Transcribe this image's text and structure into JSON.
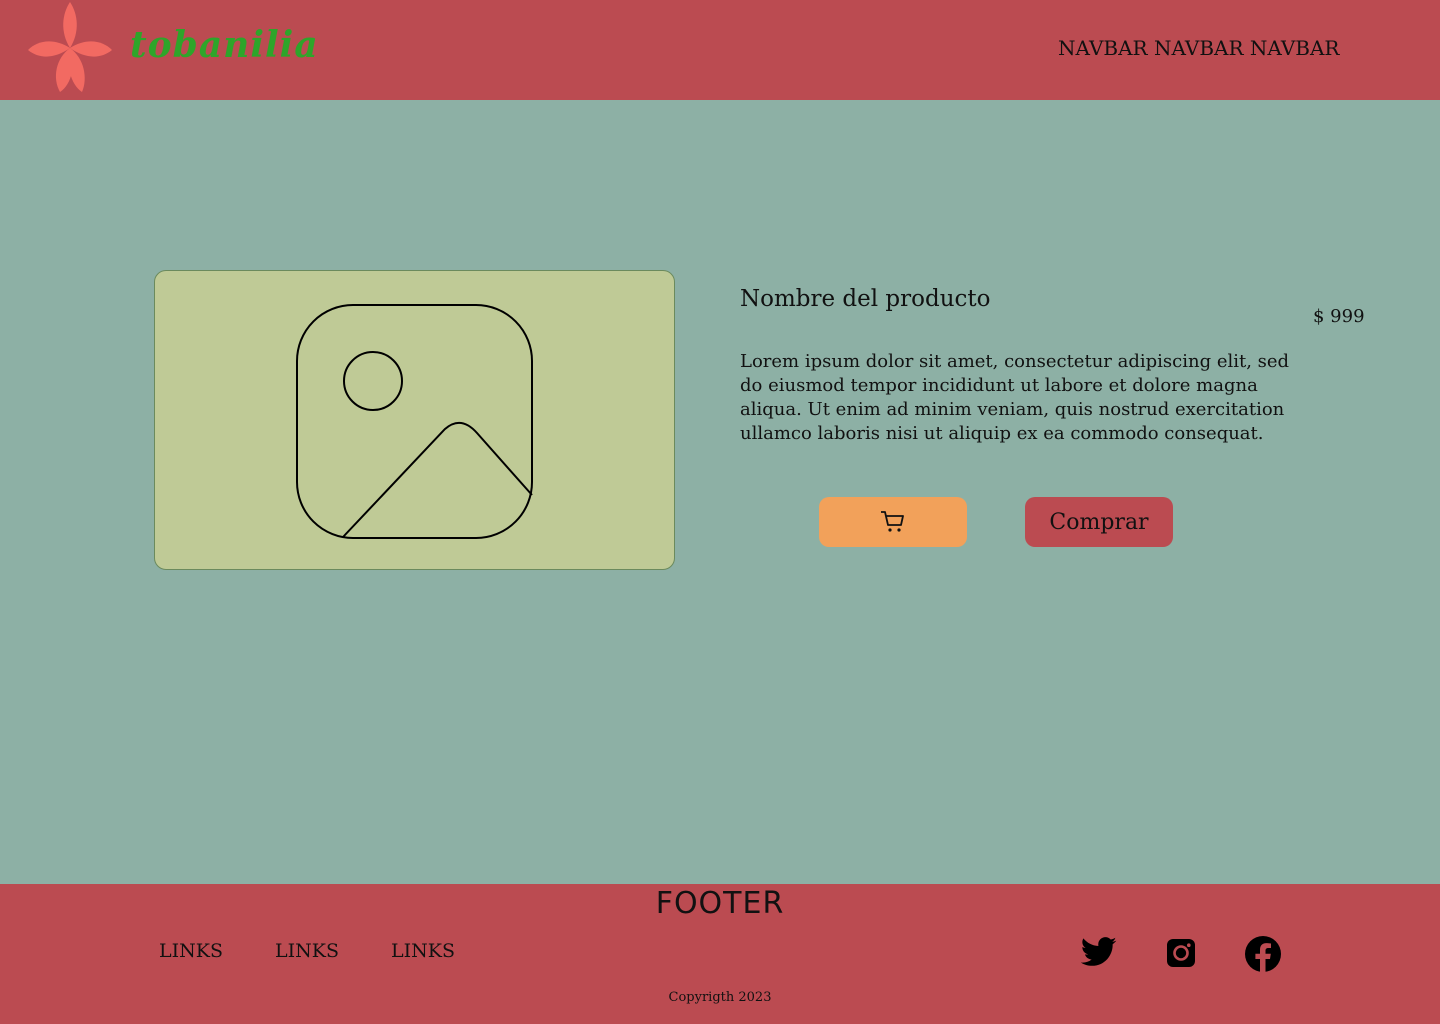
{
  "brand": {
    "logo_text": "tobanilia",
    "logo_icon": "flower-icon",
    "logo_color": "#2ea52a",
    "flower_color": "#f26a62"
  },
  "navbar": {
    "label": "NAVBAR NAVBAR NAVBAR"
  },
  "product": {
    "image_icon": "image-placeholder-icon",
    "name": "Nombre del producto",
    "price": "$ 999",
    "description": "Lorem ipsum dolor sit amet, consectetur adipiscing elit, sed do eiusmod tempor incididunt ut labore et dolore magna aliqua. Ut enim ad minim veniam, quis nostrud exercitation ullamco laboris nisi ut aliquip ex ea commodo consequat.",
    "cart_button_icon": "cart-icon",
    "buy_label": "Comprar"
  },
  "footer": {
    "title": "FOOTER",
    "links": [
      "LINKS",
      "LINKS",
      "LINKS"
    ],
    "social": [
      "twitter-icon",
      "instagram-icon",
      "facebook-icon"
    ],
    "copyright": "Copyrigth 2023"
  },
  "colors": {
    "header_bg": "#bb4b51",
    "page_bg": "#8db0a5",
    "card_bg": "#bfca96",
    "cart_button_bg": "#f2a15a",
    "buy_button_bg": "#bb4b51"
  }
}
